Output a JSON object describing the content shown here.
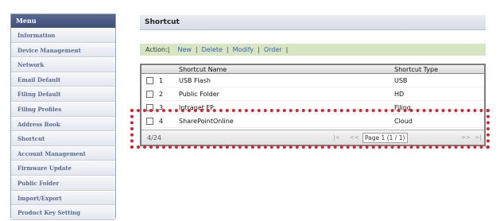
{
  "menu": {
    "header": "Menu",
    "items": [
      "Information",
      "Device Management",
      "Network",
      "Email Default",
      "Filing Default",
      "Filing Profiles",
      "Address Book",
      "Shortcut",
      "Account Management",
      "Firmware Update",
      "Public Folder",
      "Import/Export",
      "Product Key Setting"
    ]
  },
  "main": {
    "title": "Shortcut",
    "action": {
      "label": "Action:",
      "new": "New",
      "delete": "Delete",
      "modify": "Modify",
      "order": "Order",
      "separator": "|"
    },
    "table": {
      "columns": [
        "Shortcut Name",
        "Shortcut Type"
      ],
      "rows": [
        {
          "num": "1",
          "name": "USB Flash",
          "type": "USB"
        },
        {
          "num": "2",
          "name": "Public Folder",
          "type": "HD"
        },
        {
          "num": "3",
          "name": "Intranet FP",
          "type": "Filing"
        },
        {
          "num": "4",
          "name": "SharePointOnline",
          "type": "Cloud"
        }
      ],
      "footer": {
        "count": "4/24",
        "page": "Page 1 (1 / 1)",
        "first": "|<",
        "prev": "<<",
        "next": ">>",
        "last": ">|"
      }
    }
  },
  "colors": {
    "menu_header": "#3d4f7a",
    "menu_text": "#5a6a90",
    "action_bar": "#d6e6c3",
    "link": "#3b5fb8",
    "highlight": "#e0202a"
  }
}
